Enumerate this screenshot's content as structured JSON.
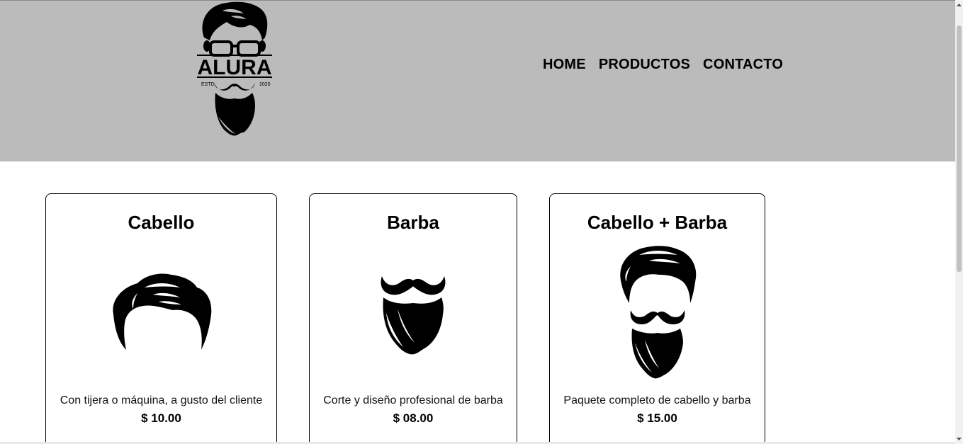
{
  "header": {
    "logo": {
      "text": "ALURA",
      "left_caption": "ESTD",
      "right_caption": "2020",
      "icon": "bearded-man-logo"
    },
    "nav": [
      {
        "label": "HOME"
      },
      {
        "label": "PRODUCTOS"
      },
      {
        "label": "CONTACTO"
      }
    ],
    "background": "#bbbbbb"
  },
  "products": [
    {
      "title": "Cabello",
      "description": "Con tijera o máquina, a gusto del cliente",
      "price": "$ 10.00",
      "icon": "hair-icon"
    },
    {
      "title": "Barba",
      "description": "Corte y diseño profesional de barba",
      "price": "$ 08.00",
      "icon": "beard-icon"
    },
    {
      "title": "Cabello + Barba",
      "description": "Paquete completo de cabello y barba",
      "price": "$ 15.00",
      "icon": "hair-and-beard-icon"
    }
  ]
}
